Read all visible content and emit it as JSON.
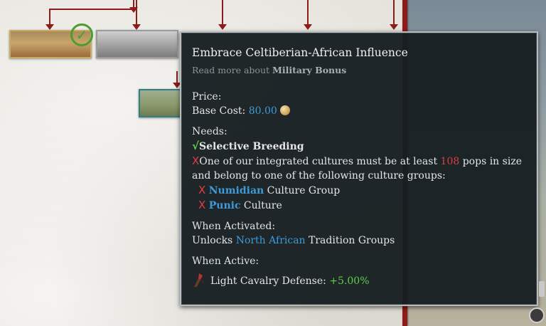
{
  "tooltip": {
    "title": "Embrace Celtiberian-African Influence",
    "read_more_prefix": "Read more about",
    "read_more_topic": "Military Bonus",
    "price_label": "Price:",
    "base_cost_label": "Base Cost:",
    "base_cost_value": "80.00",
    "needs_label": "Needs:",
    "need_met_mark": "√",
    "need_met_name": "Selective Breeding",
    "need_unmet_mark": "X",
    "need_unmet_text_1": "One of our integrated cultures must be at least",
    "need_unmet_pop": "108",
    "need_unmet_text_2": "pops in size and belong to one of the following culture groups:",
    "sub_requirements": [
      {
        "mark": "X",
        "name": "Numidian",
        "suffix": "Culture Group"
      },
      {
        "mark": "X",
        "name": "Punic",
        "suffix": "Culture"
      }
    ],
    "when_activated_label": "When Activated:",
    "unlocks_prefix": "Unlocks",
    "unlocks_link": "North African",
    "unlocks_suffix": "Tradition Groups",
    "when_active_label": "When Active:",
    "effect_name": "Light Cavalry Defense:",
    "effect_value": "+5.00%"
  },
  "icons": {
    "coin": "gold-coin-icon",
    "cavalry": "cavalry-icon",
    "check_badge": "check-badge-icon"
  },
  "colors": {
    "accent_blue": "#3e9bd8",
    "negative_red": "#e23d3d",
    "positive_green": "#5fcf4a",
    "tooltip_bg": "#161e21",
    "tree_line": "#8e1a1a"
  }
}
